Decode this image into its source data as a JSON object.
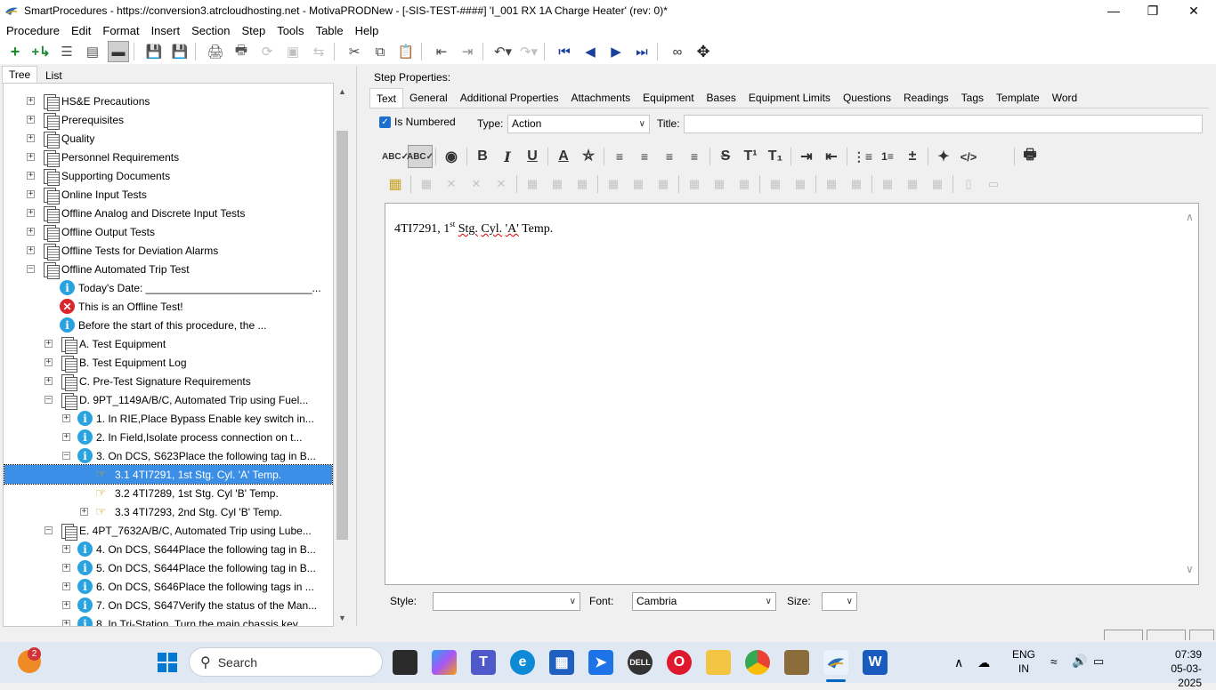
{
  "window": {
    "title": "SmartProcedures - https://conversion3.atrcloudhosting.net - MotivaPRODNew - [-SIS-TEST-####] 'I_001 RX 1A Charge Heater' (rev: 0)*"
  },
  "menu": [
    "Procedure",
    "Edit",
    "Format",
    "Insert",
    "Section",
    "Step",
    "Tools",
    "Table",
    "Help"
  ],
  "left_tabs": {
    "tree": "Tree",
    "list": "List"
  },
  "tree": {
    "nodes": [
      {
        "label": "HS&E Precautions",
        "icon": "document-icon"
      },
      {
        "label": "Prerequisites",
        "icon": "document-icon"
      },
      {
        "label": "Quality",
        "icon": "document-icon"
      },
      {
        "label": "Personnel Requirements",
        "icon": "document-icon"
      },
      {
        "label": "Supporting Documents",
        "icon": "document-icon"
      },
      {
        "label": "Online Input Tests",
        "icon": "document-icon"
      },
      {
        "label": "Offline Analog and Discrete Input Tests",
        "icon": "document-icon"
      },
      {
        "label": "Offline Output Tests",
        "icon": "document-icon"
      },
      {
        "label": "Offline Tests for Deviation Alarms",
        "icon": "document-icon"
      },
      {
        "label": "Offline Automated Trip Test",
        "icon": "document-icon"
      },
      {
        "label": "Today's Date: ____________________________...",
        "icon": "info-icon"
      },
      {
        "label": "This is an Offline Test!",
        "icon": "error-icon"
      },
      {
        "label": "Before the start of this procedure, the ...",
        "icon": "info-icon"
      },
      {
        "label": "A. Test Equipment",
        "icon": "document-icon"
      },
      {
        "label": "B. Test Equipment Log",
        "icon": "document-icon"
      },
      {
        "label": "C. Pre-Test Signature Requirements",
        "icon": "document-icon"
      },
      {
        "label": "D. 9PT_1149A/B/C, Automated Trip using Fuel...",
        "icon": "document-icon"
      },
      {
        "label": "1. In RIE,Place Bypass Enable key switch in...",
        "icon": "info-icon"
      },
      {
        "label": "2. In Field,Isolate process connection on t...",
        "icon": "info-icon"
      },
      {
        "label": "3. On DCS, S623Place the following tag in B...",
        "icon": "info-icon"
      },
      {
        "label": "3.1 4TI7291, 1st Stg. Cyl. 'A' Temp.",
        "icon": "hand-icon"
      },
      {
        "label": "3.2 4TI7289, 1st Stg. Cyl 'B' Temp.",
        "icon": "hand-icon"
      },
      {
        "label": "3.3 4TI7293, 2nd Stg. Cyl 'B' Temp.",
        "icon": "hand-icon"
      },
      {
        "label": "E. 4PT_7632A/B/C, Automated Trip using Lube...",
        "icon": "document-icon"
      },
      {
        "label": "4. On DCS, S644Place the following tag in B...",
        "icon": "info-icon"
      },
      {
        "label": "5. On DCS, S644Place the following tag in B...",
        "icon": "info-icon"
      },
      {
        "label": "6. On DCS, S646Place the following tags in ...",
        "icon": "info-icon"
      },
      {
        "label": "7. On DCS, S647Verify the status of the Man...",
        "icon": "info-icon"
      },
      {
        "label": "8. In Tri-Station, Turn the main chassis key...",
        "icon": "info-icon"
      }
    ]
  },
  "step_properties": {
    "heading": "Step Properties:",
    "tabs": [
      "Text",
      "General",
      "Additional Properties",
      "Attachments",
      "Equipment",
      "Bases",
      "Equipment Limits",
      "Questions",
      "Readings",
      "Tags",
      "Template",
      "Word"
    ],
    "is_numbered_label": "Is Numbered",
    "type_label": "Type:",
    "type_value": "Action",
    "title_label": "Title:",
    "title_value": "",
    "editor": {
      "text_before": "4TI7291, 1",
      "superscript": "st",
      "word1": "Stg.",
      "word2": "Cyl.",
      "word3": "'A'",
      "text_after": "Temp."
    },
    "style_label": "Style:",
    "style_value": "",
    "font_label": "Font:",
    "font_value": "Cambria",
    "size_label": "Size:",
    "size_value": ""
  },
  "taskbar": {
    "search_label": "Search",
    "notification_count": "2",
    "lang_line1": "ENG",
    "lang_line2": "IN",
    "time": "07:39",
    "date": "05-03-2025"
  },
  "colors": {
    "selection": "#3c8fe6",
    "accent": "#1d6fce",
    "taskbar": "#dfe8f3"
  }
}
